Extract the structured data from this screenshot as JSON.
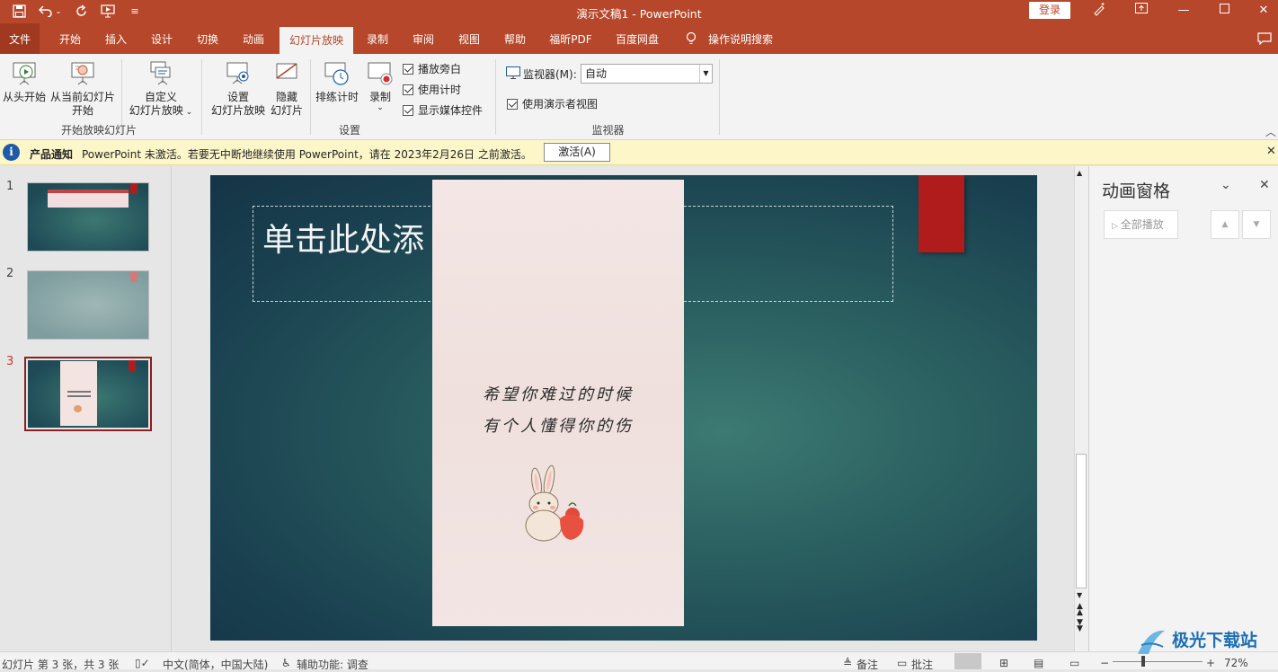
{
  "titlebar": {
    "title": "演示文稿1  -  PowerPoint",
    "login_label": "登录",
    "quick_access": [
      "save-icon",
      "undo-icon",
      "redo-icon",
      "start-from-beginning-icon",
      "customize-icon"
    ]
  },
  "tabs": [
    "文件",
    "开始",
    "插入",
    "设计",
    "切换",
    "动画",
    "幻灯片放映",
    "录制",
    "审阅",
    "视图",
    "帮助",
    "福昕PDF",
    "百度网盘",
    "操作说明搜索"
  ],
  "active_tab": "幻灯片放映",
  "ribbon": {
    "from_beginning": "从头开始",
    "from_current_1": "从当前幻灯片",
    "from_current_2": "开始",
    "custom_1": "自定义",
    "custom_2": "幻灯片放映",
    "group_start": "开始放映幻灯片",
    "setup_1": "设置",
    "setup_2": "幻灯片放映",
    "hide_1": "隐藏",
    "hide_2": "幻灯片",
    "rehearse": "排练计时",
    "record": "录制",
    "play_narration": "播放旁白",
    "use_timings": "使用计时",
    "show_media": "显示媒体控件",
    "group_setup": "设置",
    "monitor_label": "监视器(M):",
    "monitor_value": "自动",
    "presenter_view": "使用演示者视图",
    "group_monitor": "监视器"
  },
  "notification": {
    "title": "产品通知",
    "message": "PowerPoint 未激活。若要无中断地继续使用 PowerPoint，请在 2023年2月26日 之前激活。",
    "button": "激活(A)"
  },
  "thumbnails": [
    "1",
    "2",
    "3"
  ],
  "selected_slide": 3,
  "slide": {
    "title_placeholder": "单击此处添",
    "poem_line1": "希望你难过的时候",
    "poem_line2": "有个人懂得你的伤"
  },
  "animation_pane": {
    "title": "动画窗格",
    "play_all": "全部播放"
  },
  "status": {
    "slide_info": "幻灯片 第 3 张，共 3 张",
    "language": "中文(简体，中国大陆)",
    "accessibility": "辅助功能: 调查",
    "notes": "备注",
    "comments": "批注",
    "zoom": "72%"
  },
  "watermark": "极光下载站",
  "colors": {
    "accent": "#b7472a",
    "slide_bg": "#1f4f58",
    "red_bookmark": "#b01c1c",
    "card": "#f3e4e2"
  }
}
